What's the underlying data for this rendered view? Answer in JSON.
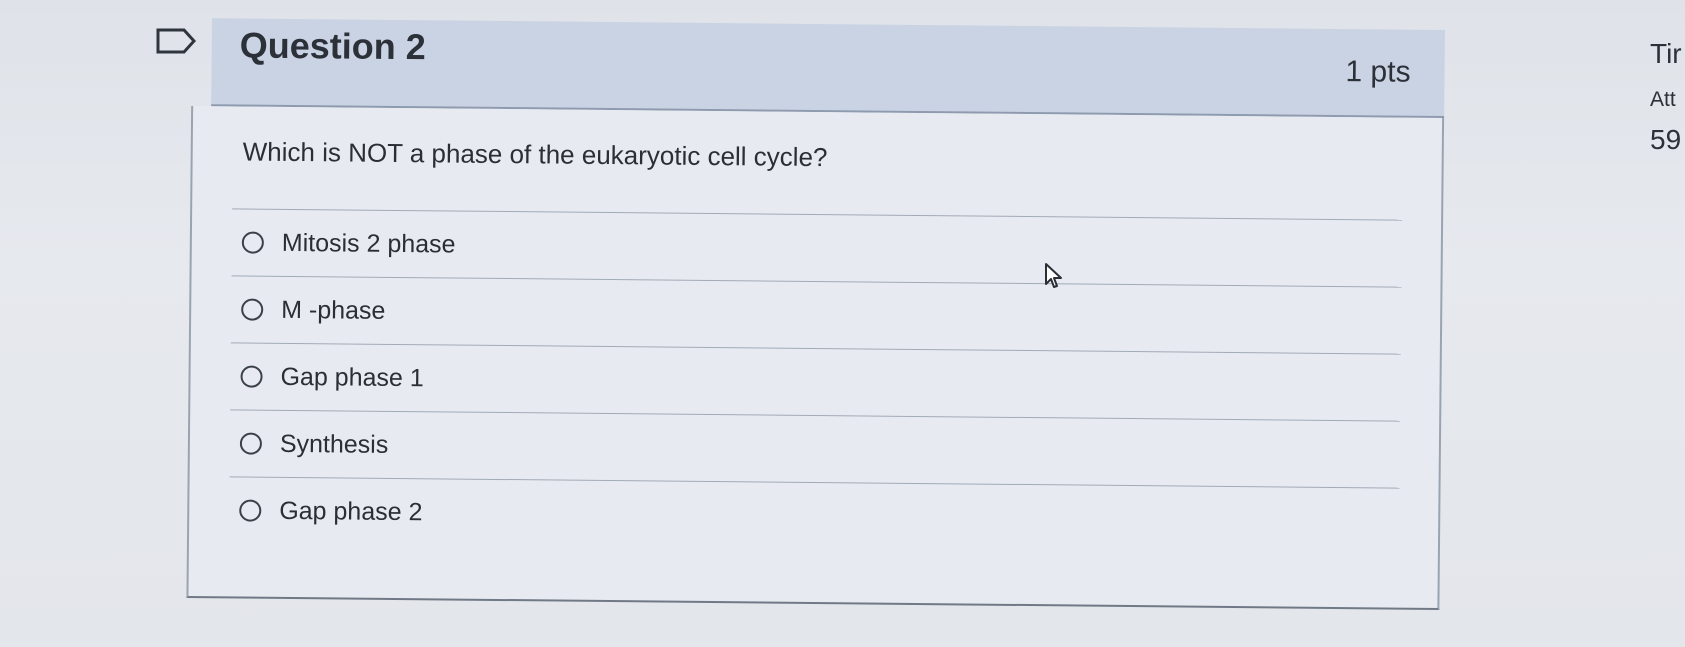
{
  "question": {
    "title": "Question 2",
    "points": "1 pts",
    "text": "Which is NOT a phase of the eukaryotic cell cycle?",
    "answers": [
      {
        "label": "Mitosis 2 phase",
        "selected": false
      },
      {
        "label": "M -phase",
        "selected": false
      },
      {
        "label": "Gap phase 1",
        "selected": false
      },
      {
        "label": "Synthesis",
        "selected": false
      },
      {
        "label": "Gap phase 2",
        "selected": false
      }
    ]
  },
  "side_panel": {
    "time_label": "Tir",
    "attempt_label": "Att",
    "number": "59"
  },
  "icons": {
    "flag": "flag-icon",
    "cursor": "mouse-pointer-icon",
    "radio": "radio-button-icon"
  },
  "colors": {
    "header_bg": "#c9d3e3",
    "body_bg": "#e7ebf1",
    "page_bg": "#e3e6eb"
  }
}
